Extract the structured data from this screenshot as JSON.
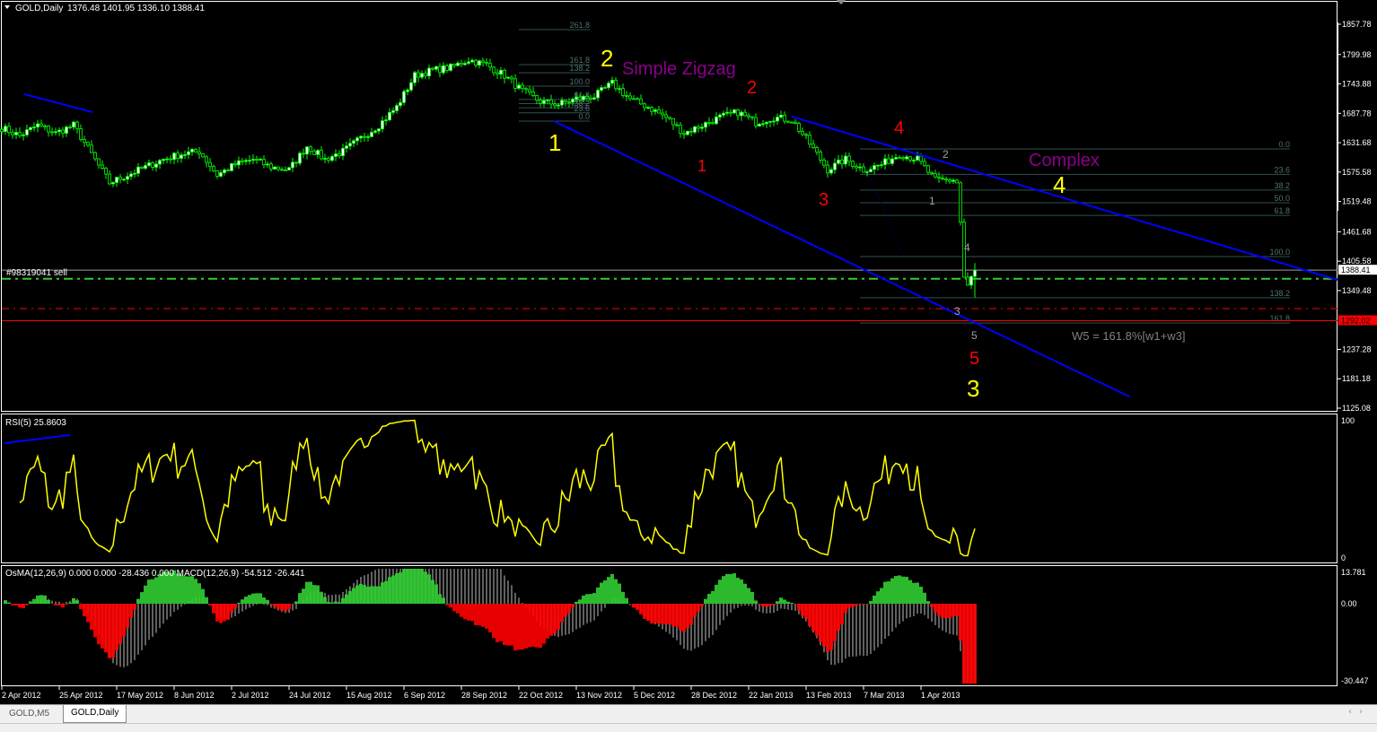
{
  "header": {
    "symbol": "GOLD,Daily",
    "ohlc": "1376.48 1401.95 1336.10 1388.41"
  },
  "rsi": {
    "label": "RSI(5) 25.8603",
    "axis": [
      "100",
      "0"
    ]
  },
  "macd": {
    "label": "OsMA(12,26,9) 0.000 0.000 -28.436 0.000  MACD(12,26,9) -54.512 -26.441",
    "axis": [
      "13.781",
      "0.00",
      "-30.447"
    ]
  },
  "order_label": "#98319041 sell",
  "colors": {
    "bull_body": "#ffffff",
    "candle_line": "#00ff00",
    "trendline": "#0000ff",
    "rsi_line": "#ffff00",
    "osma_up": "#32cd32",
    "osma_down": "#ff0000",
    "macd_bars": "#c0c0c0",
    "current_price": "#ffffff",
    "stop_line": "#ff0000",
    "take_line": "#32cd32",
    "fib": "#2f4f4f"
  },
  "price_axis": {
    "labels": [
      "1857.78",
      "1799.98",
      "1743.88",
      "1687.78",
      "1631.68",
      "1575.58",
      "1519.48",
      "1461.68",
      "1405.58",
      "1349.48",
      "1237.28",
      "1181.18",
      "1125.08"
    ],
    "current": "1388.41",
    "stop": "1292.02"
  },
  "time_axis": [
    "2 Apr 2012",
    "25 Apr 2012",
    "17 May 2012",
    "8 Jun 2012",
    "2 Jul 2012",
    "24 Jul 2012",
    "15 Aug 2012",
    "6 Sep 2012",
    "28 Sep 2012",
    "22 Oct 2012",
    "13 Nov 2012",
    "5 Dec 2012",
    "28 Dec 2012",
    "22 Jan 2013",
    "13 Feb 2013",
    "7 Mar 2013",
    "1 Apr 2013"
  ],
  "fib_left": {
    "levels": [
      "261.8",
      "161.8",
      "138.2",
      "100.0",
      "61.8",
      "50.0",
      "38.2",
      "23.6",
      "0.0"
    ],
    "price_0": 1672.9,
    "price_100": 1739.6
  },
  "fib_right": {
    "levels": [
      "0.0",
      "23.6",
      "38.2",
      "50.0",
      "61.8",
      "100.0",
      "138.2",
      "161.8"
    ],
    "price_0": 1619.8,
    "price_100": 1414.4
  },
  "annotations": {
    "y1": "1",
    "y2": "2",
    "simple_zigzag": "Simple Zigzag",
    "r2": "2",
    "r1": "1",
    "r3": "3",
    "r4": "4",
    "g2": "2",
    "g1": "1",
    "g4": "4",
    "g3": "3",
    "g5": "5",
    "r5": "5",
    "y3": "3",
    "complex": "Complex",
    "y4": "4",
    "w5": "W5 = 161.8%[w1+w3]"
  },
  "chart_data": {
    "type": "candlestick",
    "symbol": "GOLD",
    "timeframe": "Daily",
    "ylim": [
      1125.08,
      1857.78
    ],
    "closes_sampled": [
      1660,
      1645,
      1665,
      1650,
      1665,
      1610,
      1555,
      1570,
      1585,
      1600,
      1610,
      1615,
      1570,
      1590,
      1600,
      1585,
      1580,
      1625,
      1600,
      1615,
      1640,
      1665,
      1700,
      1760,
      1770,
      1775,
      1790,
      1780,
      1760,
      1730,
      1710,
      1705,
      1715,
      1720,
      1745,
      1715,
      1700,
      1680,
      1650,
      1665,
      1680,
      1690,
      1670,
      1680,
      1675,
      1630,
      1580,
      1600,
      1580,
      1590,
      1610,
      1600,
      1560,
      1560
    ],
    "last_closes": [
      1555,
      1480,
      1375,
      1360,
      1376.48,
      1388.41
    ],
    "last_bar": {
      "open": 1376.48,
      "high": 1401.95,
      "low": 1336.1,
      "close": 1388.41
    },
    "levels": {
      "current": 1388.41,
      "take_profit": 1372,
      "stop_dash": 1315,
      "stop": 1292.02
    }
  },
  "tabs": [
    {
      "label": "GOLD,M5",
      "active": false
    },
    {
      "label": "GOLD,Daily",
      "active": true
    }
  ]
}
